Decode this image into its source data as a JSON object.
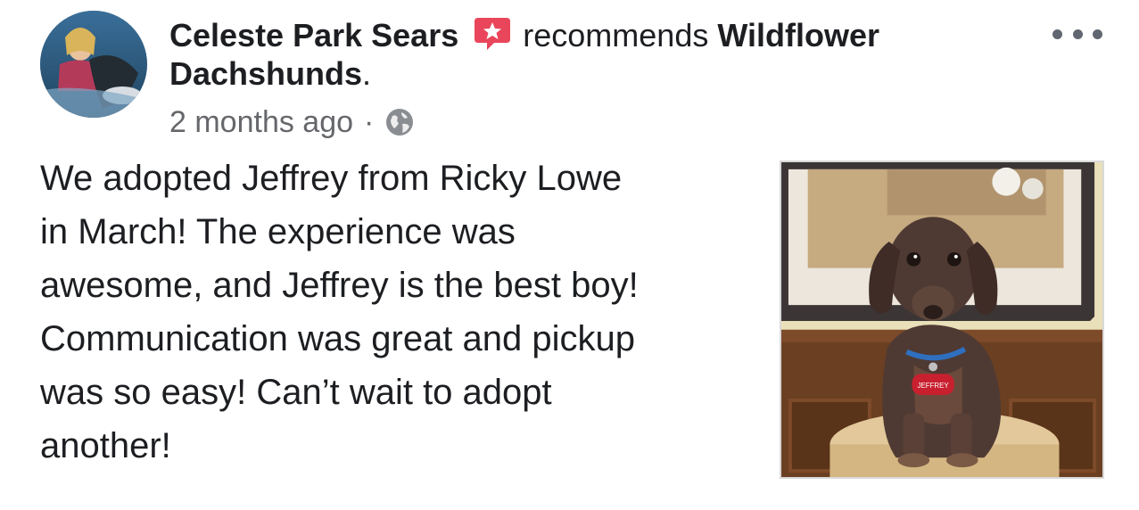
{
  "post": {
    "author": "Celeste Park Sears",
    "action": "recommends",
    "page_name_line1": "Wildflower",
    "page_name_line2": "Dachshunds",
    "period": ".",
    "timestamp": "2 months ago",
    "separator": "·",
    "privacy_icon": "globe-icon",
    "more_icon": "more-options-icon",
    "recommend_icon": "recommendation-badge-icon",
    "text": "We adopted Jeffrey from Ricky Lowe\nin March! The experience was\nawesome, and Jeffrey is the best boy!\nCommunication was great and pickup\nwas so easy! Can’t wait to adopt\nanother!",
    "photo_tag_text": "JEFFREY"
  },
  "colors": {
    "recommend_badge": "#e9465b",
    "text_primary": "#1c1e21",
    "text_secondary": "#65676b"
  }
}
